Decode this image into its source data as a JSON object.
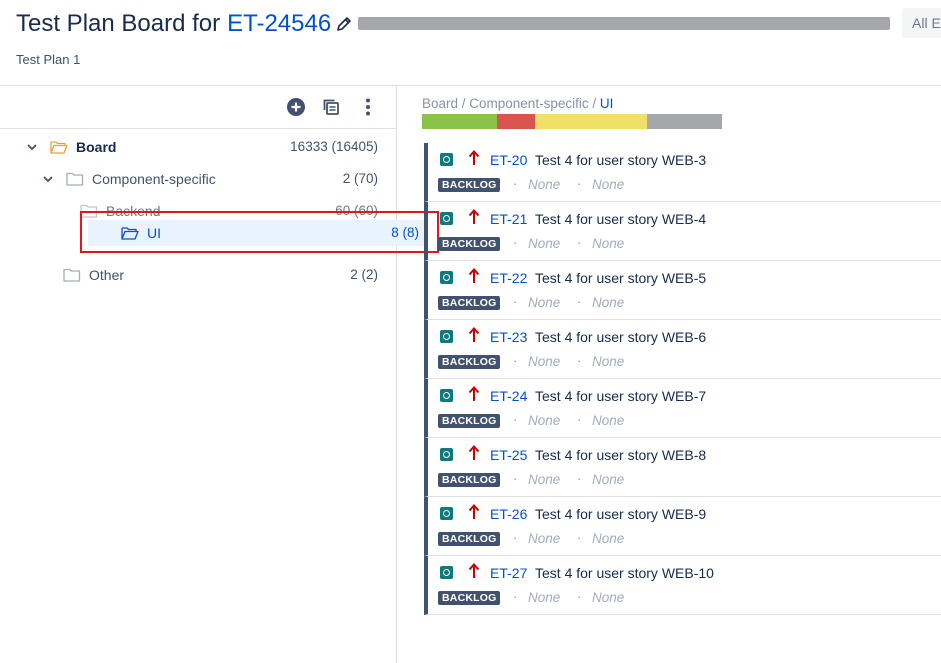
{
  "header": {
    "title_prefix": "Test Plan Board for",
    "issue_key": "ET-24546",
    "subtitle": "Test Plan 1",
    "all_button_label": "All E"
  },
  "toolbar": {
    "icons": [
      "add-icon",
      "copy-icon",
      "more-icon"
    ]
  },
  "tree": {
    "board": {
      "label": "Board",
      "count": "16333 (16405)"
    },
    "component": {
      "label": "Component-specific",
      "count": "2 (70)"
    },
    "backend": {
      "label": "Backend",
      "count": "60 (60)"
    },
    "ui": {
      "label": "UI",
      "count": "8 (8)"
    },
    "other": {
      "label": "Other",
      "count": "2 (2)"
    }
  },
  "breadcrumb": {
    "path": "Board / Component-specific / ",
    "current": "UI"
  },
  "progress": {
    "segments": [
      {
        "status": "passed",
        "color": "#8bc34a",
        "fraction": 0.25
      },
      {
        "status": "failed",
        "color": "#d9534f",
        "fraction": 0.125
      },
      {
        "status": "executing",
        "color": "#f0e06a",
        "fraction": 0.375
      },
      {
        "status": "todo",
        "color": "#a5a7ab",
        "fraction": 0.25
      }
    ]
  },
  "tests": [
    {
      "key": "ET-20",
      "summary": "Test 4 for user story WEB-3",
      "status": "BACKLOG",
      "field1": "None",
      "field2": "None"
    },
    {
      "key": "ET-21",
      "summary": "Test 4 for user story WEB-4",
      "status": "BACKLOG",
      "field1": "None",
      "field2": "None"
    },
    {
      "key": "ET-22",
      "summary": "Test 4 for user story WEB-5",
      "status": "BACKLOG",
      "field1": "None",
      "field2": "None"
    },
    {
      "key": "ET-23",
      "summary": "Test 4 for user story WEB-6",
      "status": "BACKLOG",
      "field1": "None",
      "field2": "None"
    },
    {
      "key": "ET-24",
      "summary": "Test 4 for user story WEB-7",
      "status": "BACKLOG",
      "field1": "None",
      "field2": "None"
    },
    {
      "key": "ET-25",
      "summary": "Test 4 for user story WEB-8",
      "status": "BACKLOG",
      "field1": "None",
      "field2": "None"
    },
    {
      "key": "ET-26",
      "summary": "Test 4 for user story WEB-9",
      "status": "BACKLOG",
      "field1": "None",
      "field2": "None"
    },
    {
      "key": "ET-27",
      "summary": "Test 4 for user story WEB-10",
      "status": "BACKLOG",
      "field1": "None",
      "field2": "None"
    }
  ],
  "colors": {
    "link": "#0052cc",
    "priority_high": "#cc0000",
    "test_icon": "#0e7a7e",
    "status_badge": "#42526e",
    "selection_bg": "#e9f2ff",
    "highlight_box": "#e0181c"
  }
}
